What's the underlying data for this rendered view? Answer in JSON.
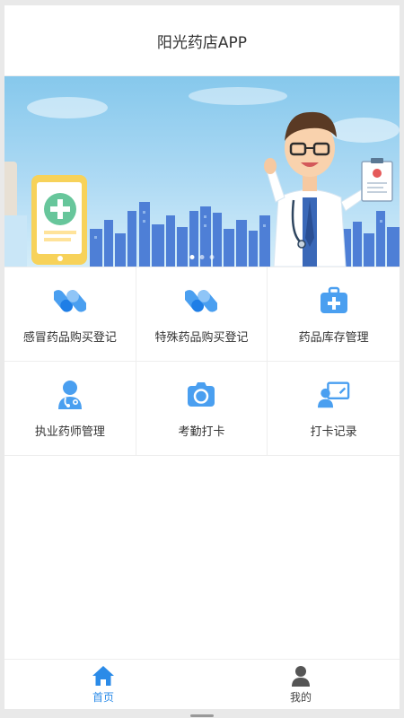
{
  "header": {
    "title": "阳光药店APP"
  },
  "banner": {
    "slide_count": 3,
    "active_index": 0
  },
  "grid": {
    "items": [
      {
        "label": "感冒药品购买登记",
        "icon": "pills-icon"
      },
      {
        "label": "特殊药品购买登记",
        "icon": "pills-icon"
      },
      {
        "label": "药品库存管理",
        "icon": "medical-kit-icon"
      },
      {
        "label": "执业药师管理",
        "icon": "doctor-icon"
      },
      {
        "label": "考勤打卡",
        "icon": "camera-icon"
      },
      {
        "label": "打卡记录",
        "icon": "presentation-user-icon"
      }
    ]
  },
  "tabbar": {
    "items": [
      {
        "label": "首页",
        "icon": "home-icon",
        "active": true
      },
      {
        "label": "我的",
        "icon": "user-icon",
        "active": false
      }
    ]
  },
  "colors": {
    "accent": "#2b8be8",
    "icon_blue": "#4a9ff0"
  }
}
